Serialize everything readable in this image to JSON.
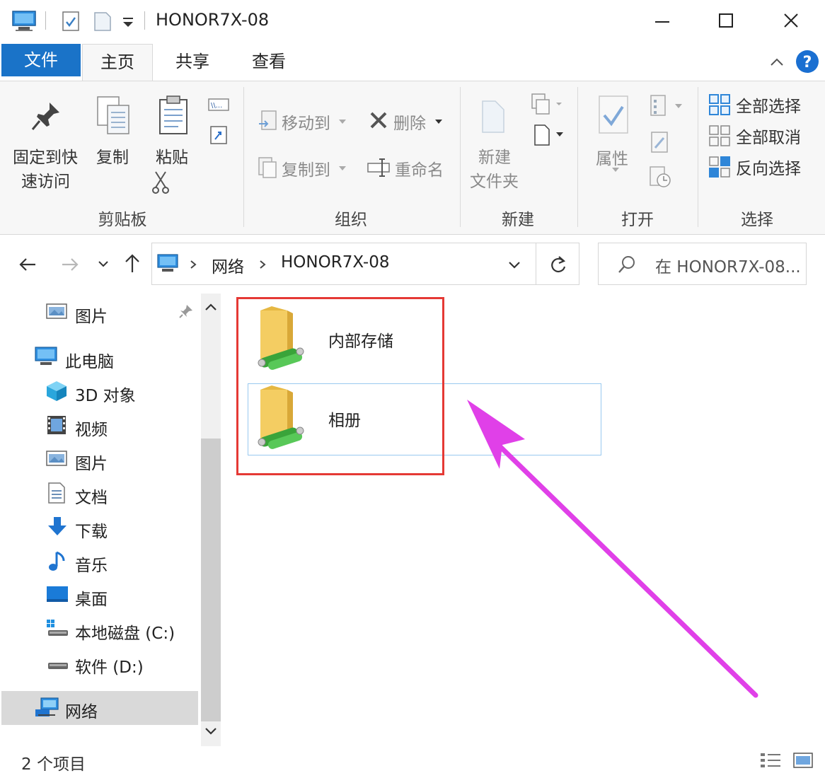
{
  "window": {
    "title": "HONOR7X-08"
  },
  "tabs": {
    "file": "文件",
    "home": "主页",
    "share": "共享",
    "view": "查看"
  },
  "ribbon": {
    "clipboard": {
      "label": "剪贴板",
      "pin_line1": "固定到快",
      "pin_line2": "速访问",
      "copy": "复制",
      "paste": "粘贴"
    },
    "organize": {
      "label": "组织",
      "move_to": "移动到",
      "delete": "删除",
      "copy_to": "复制到",
      "rename": "重命名"
    },
    "new": {
      "label": "新建",
      "new_folder_line1": "新建",
      "new_folder_line2": "文件夹"
    },
    "open": {
      "label": "打开",
      "properties": "属性"
    },
    "select": {
      "label": "选择",
      "select_all": "全部选择",
      "select_none": "全部取消",
      "invert": "反向选择"
    }
  },
  "address": {
    "crumb1": "网络",
    "crumb2": "HONOR7X-08",
    "search_placeholder": "在 HONOR7X-08..."
  },
  "nav": {
    "items": [
      {
        "label": "图片",
        "icon": "pictures-icon"
      },
      {
        "label": "此电脑",
        "icon": "this-pc-icon"
      },
      {
        "label": "3D 对象",
        "icon": "3d-objects-icon"
      },
      {
        "label": "视频",
        "icon": "videos-icon"
      },
      {
        "label": "图片",
        "icon": "pictures-icon"
      },
      {
        "label": "文档",
        "icon": "documents-icon"
      },
      {
        "label": "下载",
        "icon": "downloads-icon"
      },
      {
        "label": "音乐",
        "icon": "music-icon"
      },
      {
        "label": "桌面",
        "icon": "desktop-icon"
      },
      {
        "label": "本地磁盘 (C:)",
        "icon": "local-disk-icon"
      },
      {
        "label": "软件 (D:)",
        "icon": "drive-icon"
      },
      {
        "label": "网络",
        "icon": "network-icon"
      }
    ]
  },
  "content": {
    "items": [
      {
        "name": "内部存储",
        "icon": "network-folder-icon"
      },
      {
        "name": "相册",
        "icon": "network-folder-icon"
      }
    ]
  },
  "status": {
    "count": "2 个项目"
  },
  "colors": {
    "accent": "#1a73c8",
    "highlight_box": "#e53935",
    "arrow": "#e040e8",
    "selection_border": "#99c9ef"
  }
}
